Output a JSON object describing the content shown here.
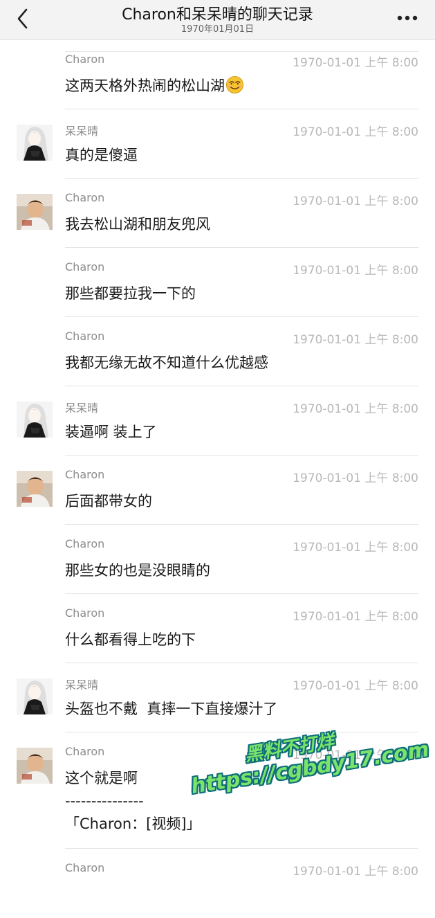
{
  "header": {
    "title": "Charon和呆呆晴的聊天记录",
    "subtitle": "1970年01月01日",
    "back_icon": "chevron-left-icon",
    "more_icon": "more-dots-icon"
  },
  "messages": [
    {
      "sender": "Charon",
      "time": "1970-01-01 上午 8:00",
      "lines": [
        "这两天格外热闹的松山湖"
      ],
      "emoji": "smiling-face-icon"
    },
    {
      "sender": "呆呆晴",
      "time": "1970-01-01 上午 8:00",
      "lines": [
        "真的是傻逼"
      ],
      "avatar": "girl-avatar"
    },
    {
      "sender": "Charon",
      "time": "1970-01-01 上午 8:00",
      "lines": [
        "我去松山湖和朋友兜风"
      ],
      "avatar": "boy-avatar"
    },
    {
      "sender": "Charon",
      "time": "1970-01-01 上午 8:00",
      "lines": [
        "那些都要拉我一下的"
      ]
    },
    {
      "sender": "Charon",
      "time": "1970-01-01 上午 8:00",
      "lines": [
        "我都无缘无故不知道什么优越感"
      ]
    },
    {
      "sender": "呆呆晴",
      "time": "1970-01-01 上午 8:00",
      "lines": [
        "装逼啊 装上了"
      ],
      "avatar": "girl-avatar"
    },
    {
      "sender": "Charon",
      "time": "1970-01-01 上午 8:00",
      "lines": [
        "后面都带女的"
      ],
      "avatar": "boy-avatar"
    },
    {
      "sender": "Charon",
      "time": "1970-01-01 上午 8:00",
      "lines": [
        "那些女的也是没眼睛的"
      ]
    },
    {
      "sender": "Charon",
      "time": "1970-01-01 上午 8:00",
      "lines": [
        "什么都看得上吃的下"
      ]
    },
    {
      "sender": "呆呆晴",
      "time": "1970-01-01 上午 8:00",
      "lines": [
        "头盔也不戴  真摔一下直接爆汁了"
      ],
      "avatar": "girl-avatar"
    },
    {
      "sender": "Charon",
      "time": "1970-01-01 上午 8:00",
      "lines": [
        "这个就是啊",
        "---------------",
        "「Charon：[视频]」"
      ],
      "avatar": "boy-avatar"
    },
    {
      "sender": "Charon",
      "time": "1970-01-01 上午 8:00",
      "lines": []
    }
  ],
  "watermark": {
    "line1": "黑料不打烊",
    "line2": "https://cgbdy17.com"
  }
}
